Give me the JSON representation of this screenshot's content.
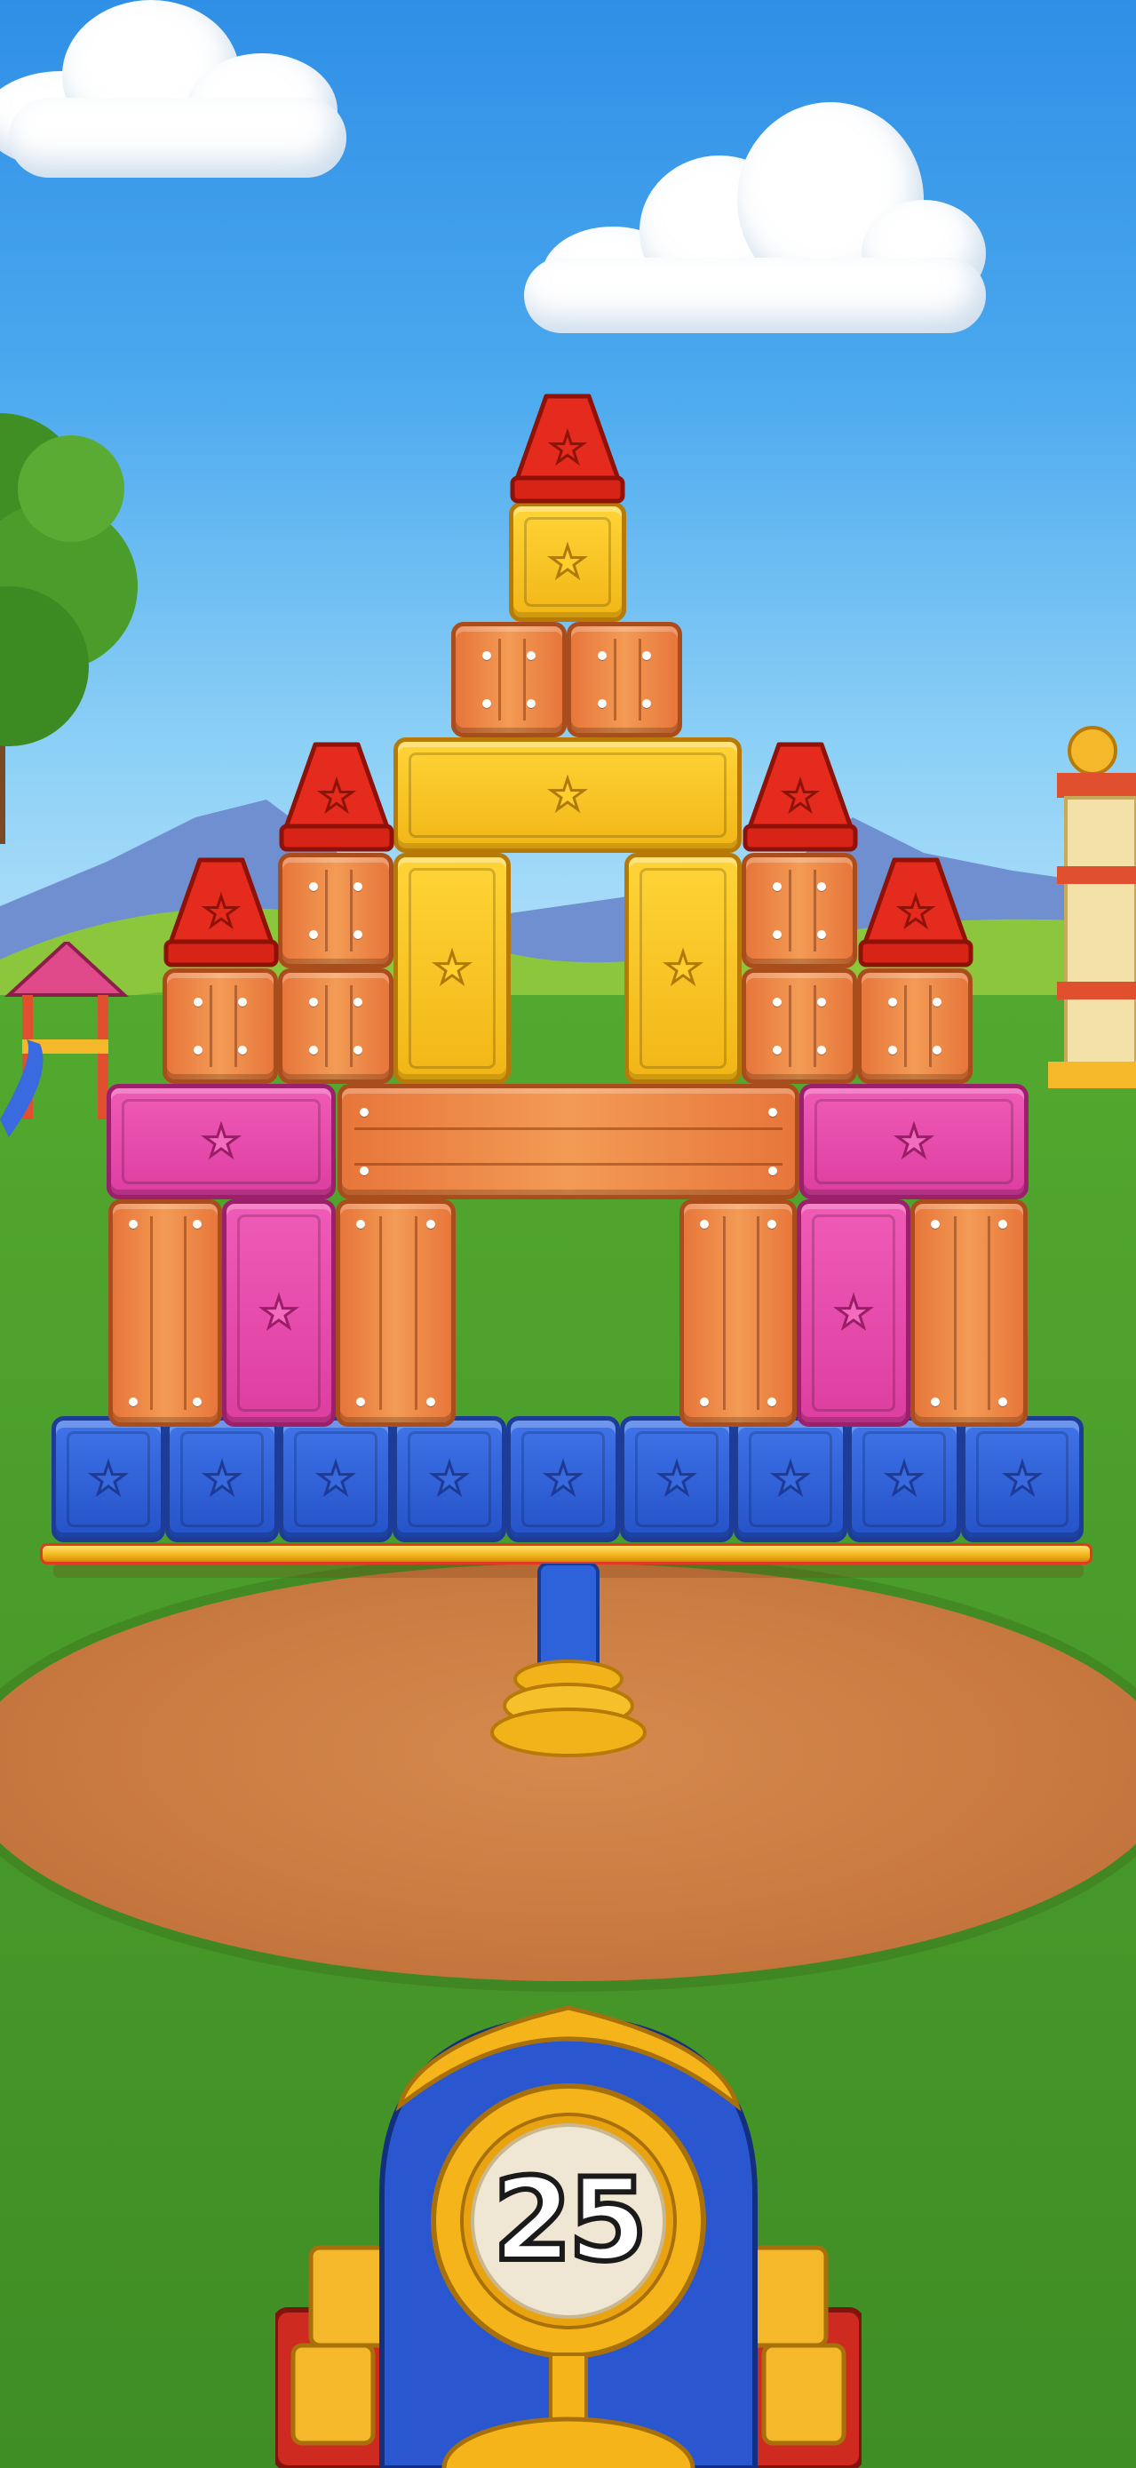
{
  "game": {
    "balls_remaining": "25"
  },
  "colors": {
    "sky": "#4aa8ee",
    "grass": "#4a9c2b",
    "dirt": "#c97a40",
    "block_blue": "#2f62d8",
    "block_orange": "#ec8545",
    "block_pink": "#e84dab",
    "block_yellow": "#f7c423",
    "roof_red": "#e02a1c",
    "cannon_blue": "#2a57d0",
    "cannon_gold": "#f4b41a",
    "cannon_red": "#cf2a1f"
  },
  "icons": [
    "star-icon",
    "cloud",
    "tree",
    "slide",
    "tower",
    "cannon"
  ]
}
